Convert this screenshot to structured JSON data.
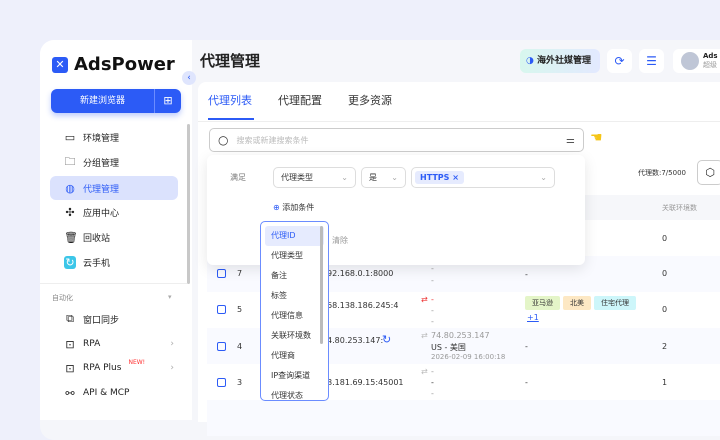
{
  "app": {
    "name": "AdsPower",
    "new_browser": "新建浏览器"
  },
  "sidebar": {
    "items": [
      {
        "label": "环境管理",
        "icon": "window-icon"
      },
      {
        "label": "分组管理",
        "icon": "folder-icon"
      },
      {
        "label": "代理管理",
        "icon": "globe-icon",
        "active": true
      },
      {
        "label": "应用中心",
        "icon": "puzzle-icon"
      },
      {
        "label": "回收站",
        "icon": "trash-icon"
      },
      {
        "label": "云手机",
        "icon": "cloud-phone-icon"
      }
    ],
    "section": "自动化",
    "auto_items": [
      {
        "label": "窗口同步"
      },
      {
        "label": "RPA"
      },
      {
        "label": "RPA Plus",
        "badge": "NEW!"
      },
      {
        "label": "API & MCP"
      }
    ]
  },
  "header": {
    "title": "代理管理",
    "social_btn": "海外社媒管理",
    "user": "Ads",
    "user_sub": "超级"
  },
  "tabs": [
    "代理列表",
    "代理配置",
    "更多资源"
  ],
  "search": {
    "placeholder": "搜索或新建搜索条件"
  },
  "filter": {
    "match": "满足",
    "field": "代理类型",
    "op": "是",
    "value": "HTTPS",
    "add": "添加条件",
    "clear": "清除"
  },
  "proxy_count": "代理数:7/5000",
  "table": {
    "col_env": "关联环境数",
    "rows": [
      {
        "id": "",
        "addr": "",
        "ip": "",
        "loc": "",
        "time": "",
        "tags": [],
        "env": "0"
      },
      {
        "id": "7",
        "addr": "92.168.0.1:8000",
        "ip": "-",
        "loc": "-",
        "time": "",
        "tags": [],
        "env": "0"
      },
      {
        "id": "5",
        "addr": "68.138.186.245:4",
        "ip": "-",
        "loc": "-",
        "time": "-",
        "tags": [
          "亚马逊",
          "北美",
          "住宅代理"
        ],
        "more": "+1",
        "env": "0"
      },
      {
        "id": "4",
        "addr": "4.80.253.147:",
        "ip": "74.80.253.147",
        "loc": "US - 美国",
        "time": "2026-02-09 16:00:18",
        "tags": [],
        "env": "2"
      },
      {
        "id": "3",
        "addr": "8.181.69.15:45001",
        "ip": "-",
        "loc": "-",
        "time": "-",
        "tags": [],
        "env": "1"
      }
    ]
  },
  "dropdown": [
    "代理ID",
    "代理类型",
    "备注",
    "标签",
    "代理信息",
    "关联环境数",
    "代理商",
    "IP查询渠道",
    "代理状态"
  ],
  "colors": {
    "accent": "#2c5bf6"
  }
}
